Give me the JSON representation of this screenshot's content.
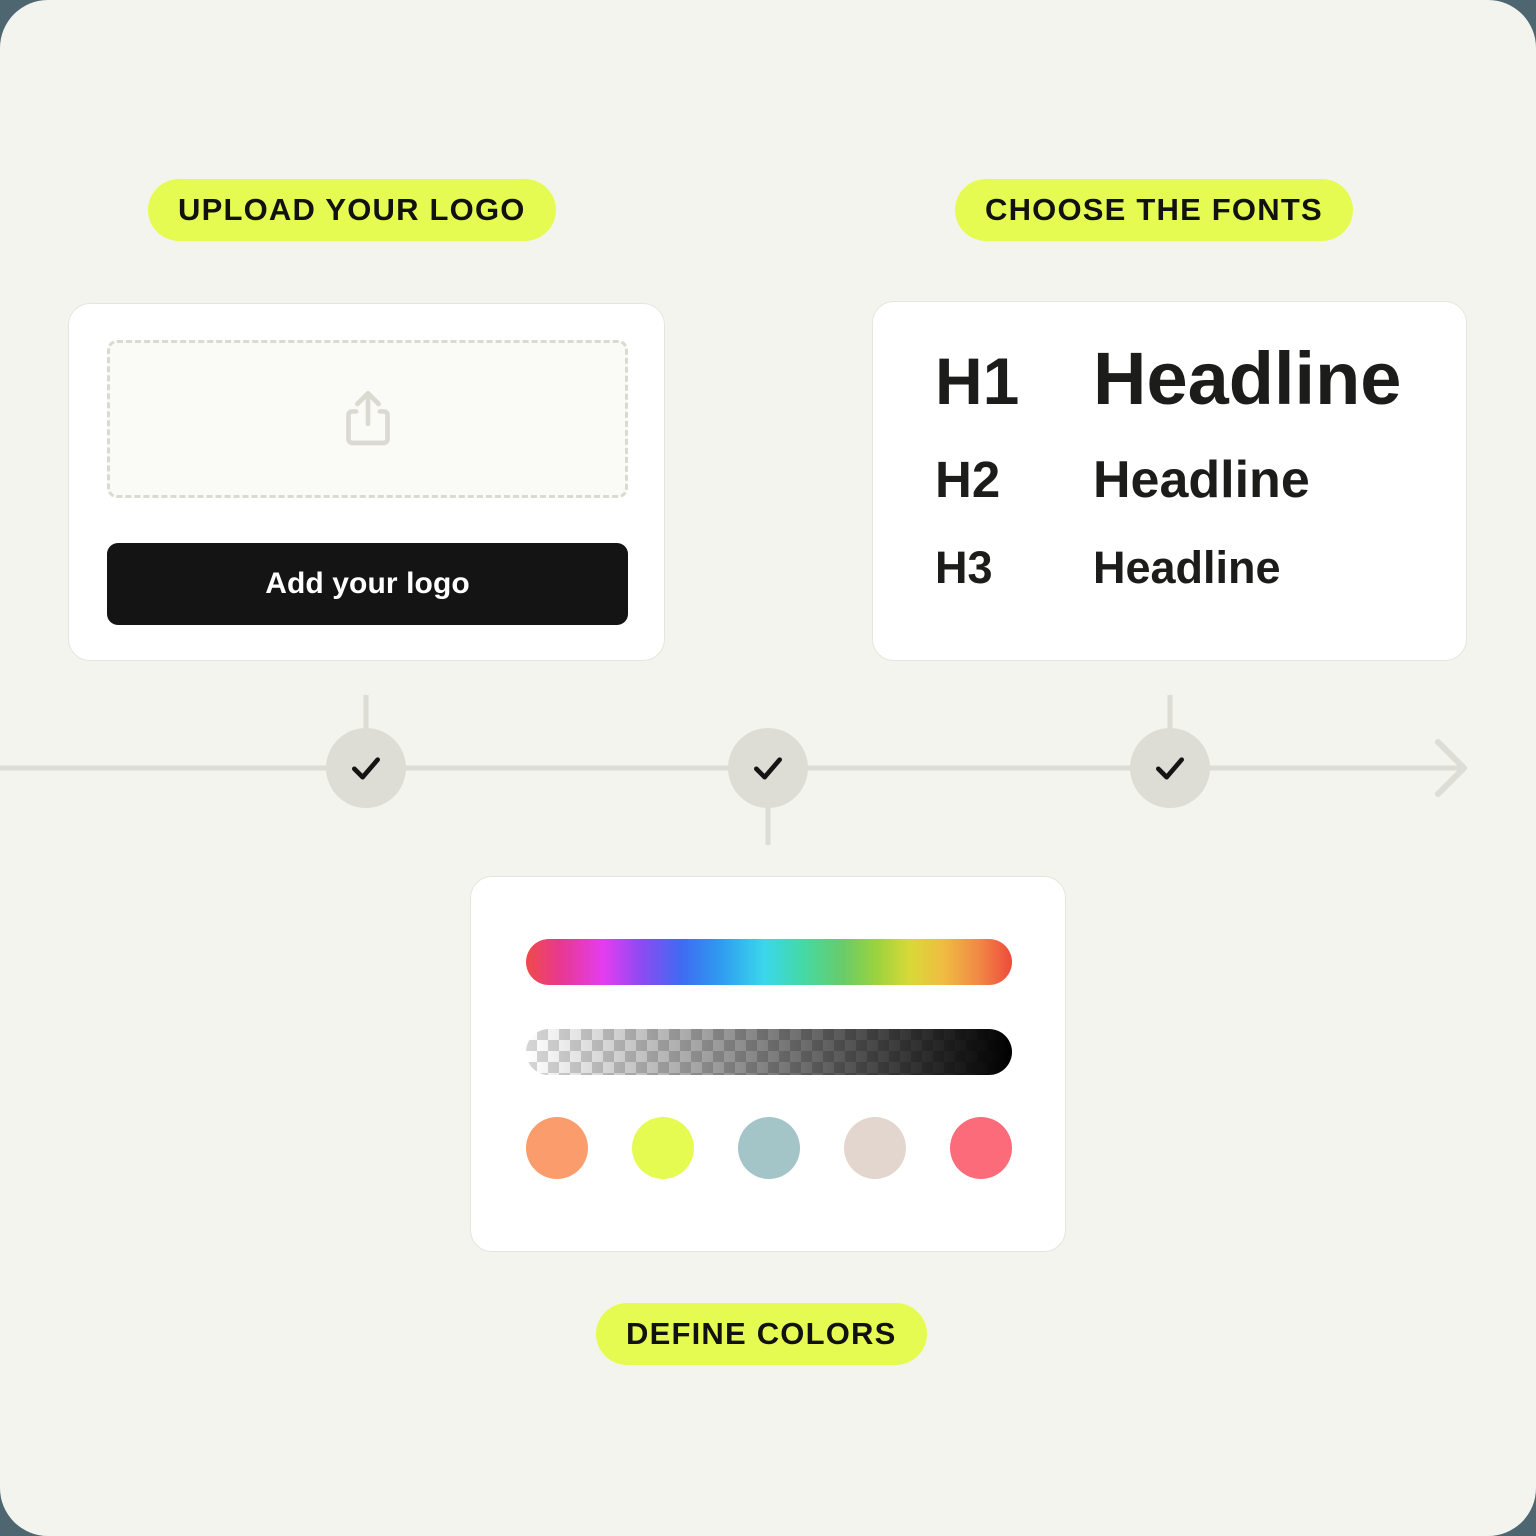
{
  "theme": {
    "page_background": "#f4f4ef",
    "outer_background": "#4e6670",
    "accent": "#e6fb51",
    "card_background": "#ffffff",
    "card_border": "#e6e5dd",
    "ink": "#141414",
    "timeline_line": "#dddcd5",
    "node_fill": "#dddcd5"
  },
  "steps": [
    {
      "label": "UPLOAD YOUR LOGO",
      "state": "complete",
      "check_icon": "check-icon"
    },
    {
      "label": "DEFINE COLORS",
      "state": "complete",
      "check_icon": "check-icon"
    },
    {
      "label": "CHOOSE THE FONTS",
      "state": "complete",
      "check_icon": "check-icon"
    }
  ],
  "logo_card": {
    "pill_label": "UPLOAD YOUR LOGO",
    "dropzone_icon": "upload-share-icon",
    "button_label": "Add your logo"
  },
  "fonts_card": {
    "pill_label": "CHOOSE THE FONTS",
    "rows": [
      {
        "tag": "H1",
        "sample": "Headline"
      },
      {
        "tag": "H2",
        "sample": "Headline"
      },
      {
        "tag": "H3",
        "sample": "Headline"
      }
    ]
  },
  "colors_card": {
    "pill_label": "DEFINE COLORS",
    "hue_slider": {
      "name": "hue-gradient-slider",
      "stops": [
        "#ef4a4a",
        "#e8388f",
        "#e33df0",
        "#8a4bf2",
        "#3f6bf2",
        "#2f9bf0",
        "#3ad7ec",
        "#45d9a5",
        "#67cc6a",
        "#9ad23f",
        "#d9d938",
        "#f0bb42",
        "#f08a45",
        "#ef4a3c"
      ]
    },
    "alpha_slider": {
      "name": "opacity-gradient-slider",
      "from": "transparent",
      "to": "#000000"
    },
    "swatches": [
      {
        "name": "swatch-orange",
        "hex": "#fb9c6c"
      },
      {
        "name": "swatch-lime",
        "hex": "#e6fb51"
      },
      {
        "name": "swatch-teal",
        "hex": "#a3c5c8"
      },
      {
        "name": "swatch-blush",
        "hex": "#e3d6ce"
      },
      {
        "name": "swatch-coral",
        "hex": "#fb6b7a"
      }
    ]
  },
  "timeline": {
    "arrow_icon": "arrow-right-icon",
    "direction": "left-to-right"
  }
}
